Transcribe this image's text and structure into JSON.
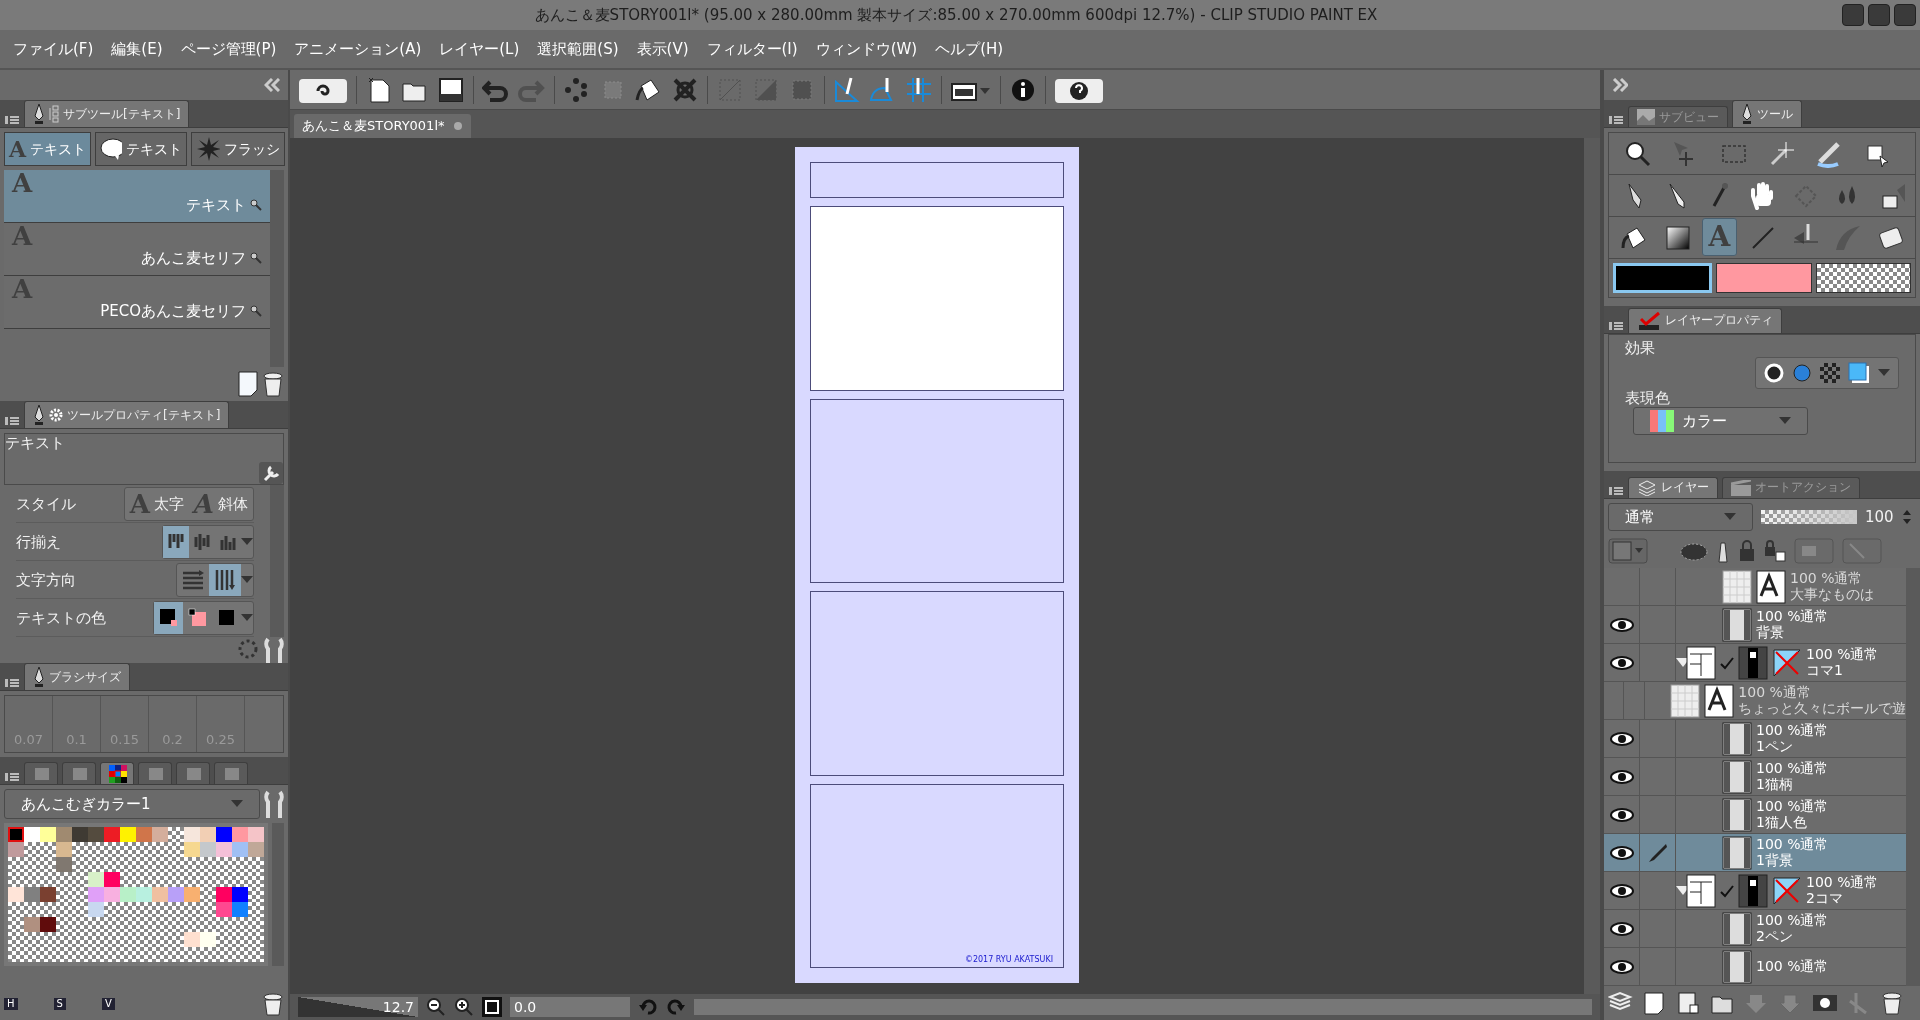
{
  "window": {
    "title": "あんこ＆麦STORY001l* (95.00 x 280.00mm 製本サイズ:85.00 x 270.00mm 600dpi 12.7%)  - CLIP STUDIO PAINT EX"
  },
  "menu": [
    "ファイル(F)",
    "編集(E)",
    "ページ管理(P)",
    "アニメーション(A)",
    "レイヤー(L)",
    "選択範囲(S)",
    "表示(V)",
    "フィルター(I)",
    "ウィンドウ(W)",
    "ヘルプ(H)"
  ],
  "toolbar": [
    [
      {
        "kind": "app",
        "disabled": false
      }
    ],
    [
      {
        "kind": "new",
        "disabled": false
      },
      {
        "kind": "open",
        "disabled": false
      },
      {
        "kind": "save",
        "disabled": false
      }
    ],
    [
      {
        "kind": "undo",
        "disabled": false
      },
      {
        "kind": "redo",
        "disabled": true
      }
    ],
    [
      {
        "kind": "dots",
        "disabled": false
      },
      {
        "kind": "crop",
        "disabled": true
      },
      {
        "kind": "fill",
        "disabled": false
      },
      {
        "kind": "transform",
        "disabled": false
      }
    ],
    [
      {
        "kind": "clear",
        "disabled": true
      },
      {
        "kind": "fillsel",
        "disabled": true
      },
      {
        "kind": "selframe",
        "disabled": true
      }
    ],
    [
      {
        "kind": "snap-ruler",
        "disabled": false
      },
      {
        "kind": "snap-curve",
        "disabled": false
      },
      {
        "kind": "snap-grid",
        "disabled": false
      }
    ],
    [
      {
        "kind": "display",
        "disabled": false
      }
    ],
    [
      {
        "kind": "info",
        "disabled": false
      }
    ],
    [
      {
        "kind": "help",
        "disabled": false
      }
    ]
  ],
  "subtool": {
    "title": "サブツール[テキスト]",
    "groups": [
      {
        "kind": "text",
        "glyph": "A",
        "label": "テキスト",
        "selected": true
      },
      {
        "kind": "balloon",
        "label": "テキスト",
        "selected": false
      },
      {
        "kind": "flash",
        "label": "フラッシ",
        "selected": false
      }
    ],
    "items": [
      {
        "glyph": "A",
        "label": "テキスト",
        "selected": true
      },
      {
        "glyph": "A",
        "label": "あんこ麦セリフ",
        "selected": false
      },
      {
        "glyph": "A",
        "label": "PECOあんこ麦セリフ",
        "selected": false
      }
    ]
  },
  "tool_property": {
    "title": "ツールプロパティ[テキスト]",
    "name": "テキスト",
    "rows": [
      {
        "kind": "style",
        "label": "スタイル",
        "options": [
          {
            "glyph": "A",
            "label": "太字",
            "selected": false
          },
          {
            "glyph": "A",
            "label": "斜体",
            "selected": false
          }
        ]
      },
      {
        "kind": "align",
        "label": "行揃え",
        "options": [
          {
            "selected": true
          },
          {
            "selected": false
          },
          {
            "selected": false
          }
        ]
      },
      {
        "kind": "direction",
        "label": "文字方向",
        "options": [
          {
            "selected": false
          },
          {
            "selected": true
          }
        ]
      },
      {
        "kind": "textcolor",
        "label": "テキストの色",
        "options": [
          {
            "selected": true
          },
          {
            "selected": false
          },
          {
            "selected": false
          }
        ]
      }
    ]
  },
  "brush_size": {
    "title": "ブラシサイズ",
    "sizes": [
      "0.07",
      "0.1",
      "0.15",
      "0.2",
      "0.25"
    ]
  },
  "color_set": {
    "tabs": [
      {
        "kind": "wheel",
        "selected": false
      },
      {
        "kind": "slider",
        "selected": false
      },
      {
        "kind": "set",
        "selected": true
      },
      {
        "kind": "history",
        "selected": false
      },
      {
        "kind": "layer",
        "selected": false
      },
      {
        "kind": "film",
        "selected": false
      }
    ],
    "name": "あんこむぎカラー1",
    "channels": [
      "H",
      "S",
      "V"
    ],
    "rows": [
      [
        {
          "kind": "color",
          "color": "#000000",
          "selected": true
        },
        {
          "kind": "color",
          "color": "#ffffff",
          "selected": false
        },
        {
          "kind": "color",
          "color": "#ffff99",
          "selected": false
        },
        {
          "kind": "color",
          "color": "#a08a70",
          "selected": false
        },
        {
          "kind": "color",
          "color": "#3f3a33",
          "selected": false
        },
        {
          "kind": "color",
          "color": "#544b3e",
          "selected": false
        },
        {
          "kind": "color",
          "color": "#ed1c24",
          "selected": false
        },
        {
          "kind": "color",
          "color": "#fff200",
          "selected": false
        },
        {
          "kind": "color",
          "color": "#d0754a",
          "selected": false
        },
        {
          "kind": "color",
          "color": "#d4ae9c",
          "selected": false
        },
        {
          "kind": "empty"
        },
        {
          "kind": "color",
          "color": "#f6e6dc",
          "selected": false
        },
        {
          "kind": "color",
          "color": "#f2cfb4",
          "selected": false
        },
        {
          "kind": "color",
          "color": "#0000ff",
          "selected": false
        },
        {
          "kind": "color",
          "color": "#ff98a0",
          "selected": false
        },
        {
          "kind": "color",
          "color": "#f5c4c8",
          "selected": false
        }
      ],
      [
        {
          "kind": "color",
          "color": "#c09a9c",
          "selected": false
        },
        {
          "kind": "empty"
        },
        {
          "kind": "empty"
        },
        {
          "kind": "color",
          "color": "#d8b890",
          "selected": false
        },
        {
          "kind": "empty"
        },
        {
          "kind": "empty"
        },
        {
          "kind": "empty"
        },
        {
          "kind": "empty"
        },
        {
          "kind": "empty"
        },
        {
          "kind": "empty"
        },
        {
          "kind": "empty"
        },
        {
          "kind": "color",
          "color": "#f6d890",
          "selected": false
        },
        {
          "kind": "color",
          "color": "#c4c8cc",
          "selected": false
        },
        {
          "kind": "color",
          "color": "#f4c0d8",
          "selected": false
        },
        {
          "kind": "color",
          "color": "#a0c0f4",
          "selected": false
        },
        {
          "kind": "color",
          "color": "#c0a898",
          "selected": false
        }
      ],
      [
        {
          "kind": "empty"
        },
        {
          "kind": "empty"
        },
        {
          "kind": "empty"
        },
        {
          "kind": "color",
          "color": "#807870",
          "selected": false
        },
        {
          "kind": "empty"
        },
        {
          "kind": "empty"
        },
        {
          "kind": "empty"
        },
        {
          "kind": "empty"
        },
        {
          "kind": "empty"
        },
        {
          "kind": "empty"
        },
        {
          "kind": "empty"
        },
        {
          "kind": "empty"
        },
        {
          "kind": "empty"
        },
        {
          "kind": "empty"
        },
        {
          "kind": "empty"
        },
        {
          "kind": "empty"
        }
      ],
      [
        {
          "kind": "empty"
        },
        {
          "kind": "empty"
        },
        {
          "kind": "empty"
        },
        {
          "kind": "empty"
        },
        {
          "kind": "empty"
        },
        {
          "kind": "color",
          "color": "#d8f0c8",
          "selected": false
        },
        {
          "kind": "color",
          "color": "#ff0060",
          "selected": false
        },
        {
          "kind": "empty"
        },
        {
          "kind": "empty"
        },
        {
          "kind": "empty"
        },
        {
          "kind": "empty"
        },
        {
          "kind": "empty"
        },
        {
          "kind": "empty"
        },
        {
          "kind": "empty"
        },
        {
          "kind": "empty"
        },
        {
          "kind": "empty"
        }
      ],
      [
        {
          "kind": "color",
          "color": "#ffe4d8",
          "selected": false
        },
        {
          "kind": "color",
          "color": "#808080",
          "selected": false
        },
        {
          "kind": "color",
          "color": "#7a4030",
          "selected": false
        },
        {
          "kind": "empty"
        },
        {
          "kind": "empty"
        },
        {
          "kind": "color",
          "color": "#e0a0f8",
          "selected": false
        },
        {
          "kind": "color",
          "color": "#f8b0e0",
          "selected": false
        },
        {
          "kind": "color",
          "color": "#b8f0c8",
          "selected": false
        },
        {
          "kind": "color",
          "color": "#b8f0e0",
          "selected": false
        },
        {
          "kind": "color",
          "color": "#f0c0a0",
          "selected": false
        },
        {
          "kind": "color",
          "color": "#b8a0f8",
          "selected": false
        },
        {
          "kind": "color",
          "color": "#f8b070",
          "selected": false
        },
        {
          "kind": "empty"
        },
        {
          "kind": "color",
          "color": "#ff0060",
          "selected": false
        },
        {
          "kind": "color",
          "color": "#0000ff",
          "selected": false
        },
        {
          "kind": "empty"
        }
      ],
      [
        {
          "kind": "empty"
        },
        {
          "kind": "empty"
        },
        {
          "kind": "empty"
        },
        {
          "kind": "empty"
        },
        {
          "kind": "empty"
        },
        {
          "kind": "color",
          "color": "#c8d8f0",
          "selected": false
        },
        {
          "kind": "empty"
        },
        {
          "kind": "empty"
        },
        {
          "kind": "empty"
        },
        {
          "kind": "empty"
        },
        {
          "kind": "empty"
        },
        {
          "kind": "empty"
        },
        {
          "kind": "empty"
        },
        {
          "kind": "color",
          "color": "#ff4890",
          "selected": false
        },
        {
          "kind": "color",
          "color": "#1080ff",
          "selected": false
        },
        {
          "kind": "empty"
        }
      ],
      [
        {
          "kind": "empty"
        },
        {
          "kind": "color",
          "color": "#b09080",
          "selected": false
        },
        {
          "kind": "color",
          "color": "#600c0c",
          "selected": false
        },
        {
          "kind": "empty"
        },
        {
          "kind": "empty"
        },
        {
          "kind": "empty"
        },
        {
          "kind": "empty"
        },
        {
          "kind": "empty"
        },
        {
          "kind": "empty"
        },
        {
          "kind": "empty"
        },
        {
          "kind": "empty"
        },
        {
          "kind": "empty"
        },
        {
          "kind": "empty"
        },
        {
          "kind": "empty"
        },
        {
          "kind": "empty"
        },
        {
          "kind": "empty"
        }
      ],
      [
        {
          "kind": "empty"
        },
        {
          "kind": "empty"
        },
        {
          "kind": "empty"
        },
        {
          "kind": "empty"
        },
        {
          "kind": "empty"
        },
        {
          "kind": "empty"
        },
        {
          "kind": "empty"
        },
        {
          "kind": "empty"
        },
        {
          "kind": "empty"
        },
        {
          "kind": "empty"
        },
        {
          "kind": "empty"
        },
        {
          "kind": "color",
          "color": "#ffe0d0",
          "selected": false
        },
        {
          "kind": "color",
          "color": "#fffff0",
          "selected": false
        },
        {
          "kind": "empty"
        },
        {
          "kind": "empty"
        },
        {
          "kind": "empty"
        }
      ],
      [
        {
          "kind": "empty"
        },
        {
          "kind": "empty"
        },
        {
          "kind": "empty"
        },
        {
          "kind": "empty"
        },
        {
          "kind": "empty"
        },
        {
          "kind": "empty"
        },
        {
          "kind": "empty"
        },
        {
          "kind": "empty"
        },
        {
          "kind": "empty"
        },
        {
          "kind": "empty"
        },
        {
          "kind": "empty"
        },
        {
          "kind": "empty"
        },
        {
          "kind": "empty"
        },
        {
          "kind": "empty"
        },
        {
          "kind": "empty"
        },
        {
          "kind": "empty"
        }
      ]
    ]
  },
  "canvas": {
    "tab": "あんこ＆麦STORY001l*",
    "frames": [
      {
        "selected": false
      },
      {
        "selected": true
      },
      {
        "selected": false
      },
      {
        "selected": false
      },
      {
        "selected": false
      }
    ],
    "credit": "©2017 RYU AKATSUKI"
  },
  "status_bar": {
    "zoom": "12.7",
    "rotation": "0.0"
  },
  "tool_panel": {
    "tabs": [
      {
        "label": "サブビュー",
        "selected": false
      },
      {
        "label": "ツール",
        "selected": true
      }
    ],
    "tools": [
      [
        {
          "kind": "zoom",
          "selected": false
        },
        {
          "kind": "move",
          "selected": false
        },
        {
          "kind": "select",
          "selected": false
        },
        {
          "kind": "wand",
          "selected": false
        },
        {
          "kind": "eraser-sel",
          "selected": false
        },
        {
          "kind": "object",
          "selected": false
        }
      ],
      [
        {
          "kind": "pen",
          "selected": false
        },
        {
          "kind": "pencil",
          "selected": false
        },
        {
          "kind": "brush",
          "selected": false
        },
        {
          "kind": "hand",
          "selected": false
        },
        {
          "kind": "blend",
          "selected": false
        },
        {
          "kind": "drops",
          "selected": false
        },
        {
          "kind": "spray",
          "selected": false
        }
      ],
      [
        {
          "kind": "bucket",
          "selected": false
        },
        {
          "kind": "gradient",
          "selected": false
        },
        {
          "kind": "text",
          "glyph": "A",
          "selected": true
        },
        {
          "kind": "line",
          "selected": false
        },
        {
          "kind": "ruler",
          "selected": false
        },
        {
          "kind": "curve",
          "selected": false
        },
        {
          "kind": "eraser",
          "selected": false
        }
      ]
    ],
    "colors": [
      {
        "kind": "main",
        "color": "#000000",
        "selected": true
      },
      {
        "kind": "sub",
        "color": "#ff98a0",
        "selected": false
      },
      {
        "kind": "transparent",
        "selected": false
      }
    ]
  },
  "layer_property": {
    "title": "レイヤープロパティ",
    "effect_label": "効果",
    "color_label": "表現色",
    "color_mode": "カラー"
  },
  "layer_panel": {
    "tabs": [
      {
        "label": "レイヤー",
        "selected": true
      },
      {
        "label": "オートアクション",
        "selected": false
      }
    ],
    "blend_mode": "通常",
    "opacity": "100",
    "opacity_slider": {
      "level": 1
    },
    "layers": [
      {
        "children": [
          {
            "kind": "text",
            "info": "100 %通常",
            "name": "大事なものは",
            "visible": false,
            "selected": false
          },
          {
            "kind": "raster",
            "info": "100 %通常",
            "name": "背景",
            "visible": true,
            "selected": false
          }
        ]
      },
      {
        "kind": "frame",
        "info": "100 %通常",
        "name": "コマ1",
        "visible": true,
        "selected": false,
        "expanded": true,
        "children": [
          {
            "kind": "text",
            "info": "100 %通常",
            "name": "ちょっと久々にボールで遊",
            "visible": false,
            "selected": false
          },
          {
            "kind": "raster",
            "info": "100 %通常",
            "name": "1ペン",
            "visible": true,
            "selected": false
          },
          {
            "kind": "raster",
            "info": "100 %通常",
            "name": "1猫柄",
            "visible": true,
            "selected": false
          },
          {
            "kind": "raster",
            "info": "100 %通常",
            "name": "1猫人色",
            "visible": true,
            "selected": false
          },
          {
            "kind": "raster",
            "info": "100 %通常",
            "name": "1背景",
            "visible": true,
            "selected": true
          }
        ]
      },
      {
        "kind": "frame",
        "info": "100 %通常",
        "name": "2コマ",
        "visible": true,
        "selected": false,
        "expanded": true,
        "children": [
          {
            "kind": "raster",
            "info": "100 %通常",
            "name": "2ペン",
            "visible": true,
            "selected": false
          },
          {
            "kind": "raster",
            "info": "100 %通常",
            "visible": true,
            "selected": false
          }
        ]
      }
    ]
  }
}
